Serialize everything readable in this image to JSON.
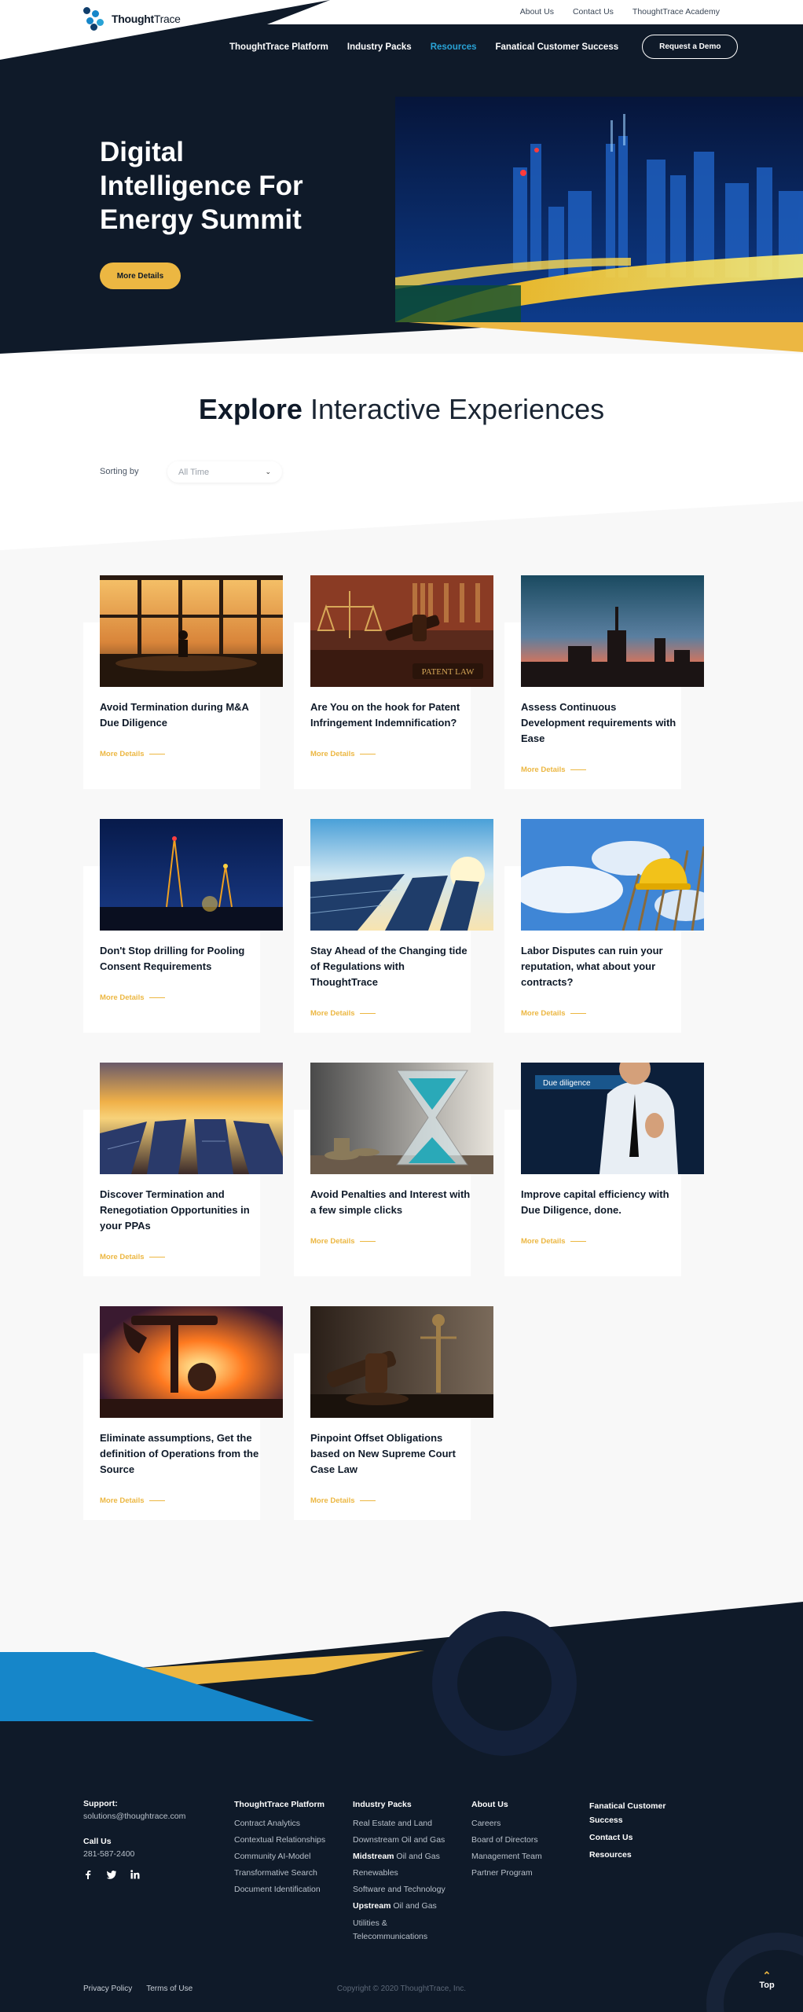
{
  "brand": {
    "name_bold": "Thought",
    "name_light": "Trace"
  },
  "top_links": [
    "About Us",
    "Contact Us",
    "ThoughtTrace Academy"
  ],
  "main_nav": {
    "items": [
      "ThoughtTrace Platform",
      "Industry Packs",
      "Resources",
      "Fanatical Customer Success"
    ],
    "active": "Resources",
    "cta": "Request a Demo"
  },
  "hero": {
    "title": "Digital Intelligence For Energy Summit",
    "button": "More Details"
  },
  "explore": {
    "title_bold": "Explore",
    "title_light": "Interactive Experiences",
    "sort_label": "Sorting by",
    "sort_value": "All Time"
  },
  "cards": [
    {
      "title": "Avoid Termination during M&A Due Diligence",
      "more": "More Details"
    },
    {
      "title": "Are You on the hook for Patent Infringement Indemnification?",
      "more": "More Details",
      "image_text": "PATENT LAW"
    },
    {
      "title": "Assess Continuous Development requirements with Ease",
      "more": "More Details"
    },
    {
      "title": "Don't Stop drilling for Pooling Consent Requirements",
      "more": "More Details"
    },
    {
      "title": "Stay Ahead of the Changing tide of Regulations with ThoughtTrace",
      "more": "More Details"
    },
    {
      "title": "Labor Disputes can ruin your reputation, what about your contracts?",
      "more": "More Details"
    },
    {
      "title": "Discover Termination and Renegotiation Opportunities in your PPAs",
      "more": "More Details"
    },
    {
      "title": "Avoid Penalties and Interest with a few simple clicks",
      "more": "More Details"
    },
    {
      "title": "Improve capital efficiency with Due Diligence, done.",
      "more": "More Details",
      "image_text": "Due diligence"
    },
    {
      "title": "Eliminate assumptions, Get the definition of Operations from the Source",
      "more": "More Details"
    },
    {
      "title": "Pinpoint Offset Obligations based on New Supreme Court Case Law",
      "more": "More Details"
    }
  ],
  "footer": {
    "support_label": "Support:",
    "support_email": "solutions@thoughtrace.com",
    "call_label": "Call Us",
    "phone": "281-587-2400",
    "social_icons": [
      "facebook-icon",
      "twitter-icon",
      "linkedin-icon"
    ],
    "platform": {
      "heading": "ThoughtTrace Platform",
      "items": [
        "Contract Analytics",
        "Contextual Relationships",
        "Community AI-Model",
        "Transformative Search",
        "Document Identification"
      ]
    },
    "industry": {
      "heading": "Industry Packs",
      "items": [
        {
          "bold": "",
          "text": "Real Estate and Land"
        },
        {
          "bold": "",
          "text": "Downstream Oil and Gas"
        },
        {
          "bold": "Midstream",
          "text": " Oil and Gas"
        },
        {
          "bold": "",
          "text": "Renewables"
        },
        {
          "bold": "",
          "text": "Software and Technology"
        },
        {
          "bold": "Upstream",
          "text": " Oil and Gas"
        },
        {
          "bold": "",
          "text": "Utilities & Telecommunications"
        }
      ]
    },
    "about": {
      "heading": "About Us",
      "items": [
        "Careers",
        "Board of Directors",
        "Management Team",
        "Partner Program"
      ]
    },
    "success": {
      "heading": "Fanatical Customer Success",
      "links": [
        "Contact Us",
        "Resources"
      ]
    },
    "legal": [
      "Privacy Policy",
      "Terms of Use"
    ],
    "copyright": "Copyright © 2020 ThoughtTrace, Inc.",
    "top_label": "Top"
  },
  "colors": {
    "navy": "#0f1a29",
    "gold": "#ecb742",
    "blue": "#1686c9",
    "active_nav": "#29a3d6"
  }
}
